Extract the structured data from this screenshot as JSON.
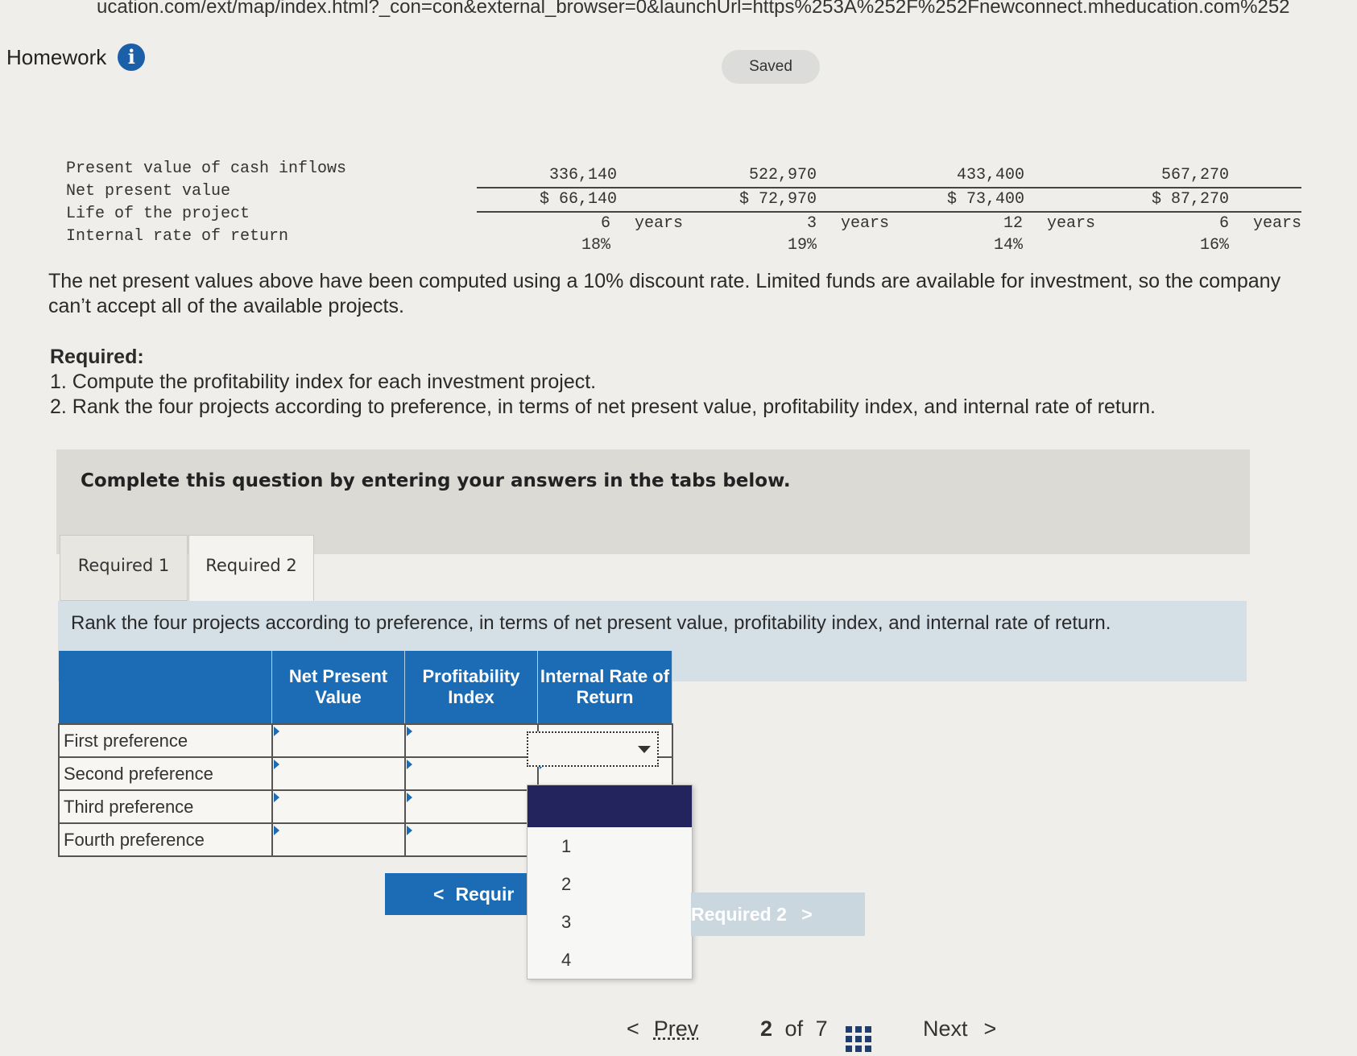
{
  "browser": {
    "url": "ucation.com/ext/map/index.html?_con=con&external_browser=0&launchUrl=https%253A%252F%252Fnewconnect.mheducation.com%252"
  },
  "header": {
    "title": "Homework",
    "saved_label": "Saved"
  },
  "data_table": {
    "row_labels": [
      "Present value of cash inflows",
      "Net present value",
      "Life of the project",
      "Internal rate of return"
    ],
    "years_label": "years",
    "projects": [
      {
        "pv_inflows": "336,140",
        "npv": "$ 66,140",
        "life": "6",
        "irr": "18%"
      },
      {
        "pv_inflows": "522,970",
        "npv": "$ 72,970",
        "life": "3",
        "irr": "19%"
      },
      {
        "pv_inflows": "433,400",
        "npv": "$ 73,400",
        "life": "12",
        "irr": "14%"
      },
      {
        "pv_inflows": "567,270",
        "npv": "$ 87,270",
        "life": "6",
        "irr": "16%"
      }
    ]
  },
  "paragraph": "The net present values above have been computed using a 10% discount rate. Limited funds are available for investment, so the company can’t accept all of the available projects.",
  "required": {
    "heading": "Required:",
    "items": [
      "1. Compute the profitability index for each investment project.",
      "2. Rank the four projects according to preference, in terms of net present value, profitability index, and internal rate of return."
    ]
  },
  "complete_banner": "Complete this question by entering your answers in the tabs below.",
  "tabs": [
    {
      "label": "Required 1"
    },
    {
      "label": "Required 2"
    }
  ],
  "instruction": "Rank the four projects according to preference, in terms of net present value, profitability index, and internal rate of return.",
  "rank_table": {
    "headers": [
      "Net Present Value",
      "Profitability Index",
      "Internal Rate of Return"
    ],
    "rows": [
      "First preference",
      "Second preference",
      "Third preference",
      "Fourth preference"
    ]
  },
  "dropdown": {
    "options": [
      "1",
      "2",
      "3",
      "4"
    ]
  },
  "buttons": {
    "prev_label": "Requir",
    "next_label": "Required 2"
  },
  "pagination": {
    "prev": "Prev",
    "current": "2",
    "of_label": "of",
    "total": "7",
    "next": "Next"
  }
}
